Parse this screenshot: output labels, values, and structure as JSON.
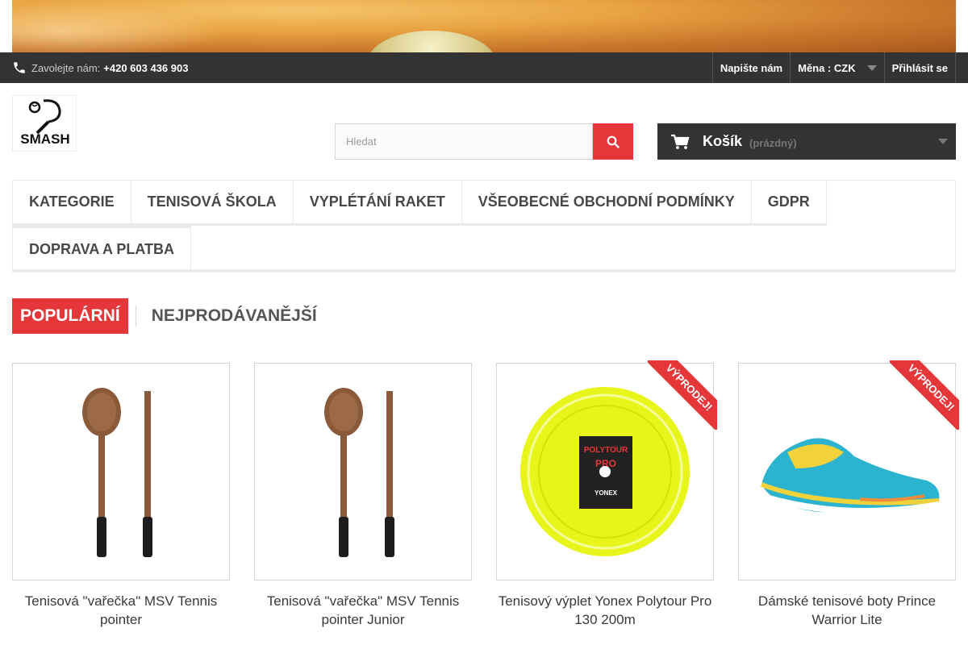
{
  "topbar": {
    "contact_label": "Zavolejte nám:",
    "phone": "+420 603 436 903",
    "contact_link": "Napište nám",
    "currency": "Měna : CZK",
    "login": "Přihlásit se"
  },
  "logo": {
    "text": "SMASH"
  },
  "search": {
    "placeholder": "Hledat"
  },
  "cart": {
    "label": "Košík",
    "status": "(prázdný)"
  },
  "menu": {
    "row1": [
      "KATEGORIE",
      "TENISOVÁ ŠKOLA",
      "VYPLÉTÁNÍ RAKET",
      "VŠEOBECNÉ OBCHODNÍ PODMÍNKY",
      "GDPR"
    ],
    "row2": [
      "DOPRAVA A PLATBA"
    ]
  },
  "tabs": {
    "popular": "POPULÁRNÍ",
    "bestsellers": "NEJPRODÁVANĚJŠÍ"
  },
  "products": [
    {
      "name": "Tenisová \"vařečka\" MSV Tennis pointer",
      "sale": false
    },
    {
      "name": "Tenisová \"vařečka\" MSV Tennis pointer Junior",
      "sale": false
    },
    {
      "name": "Tenisový výplet Yonex Polytour Pro 130 200m",
      "sale": true,
      "sale_label": "VÝPRODEJ!",
      "reel_brand": "POLYTOUR",
      "reel_sub": "PRO",
      "reel_maker": "YONEX"
    },
    {
      "name": "Dámské tenisové boty Prince Warrior Lite",
      "sale": true,
      "sale_label": "VÝPRODEJ!"
    }
  ],
  "colors": {
    "accent": "#e5373a",
    "dark": "#333333"
  }
}
